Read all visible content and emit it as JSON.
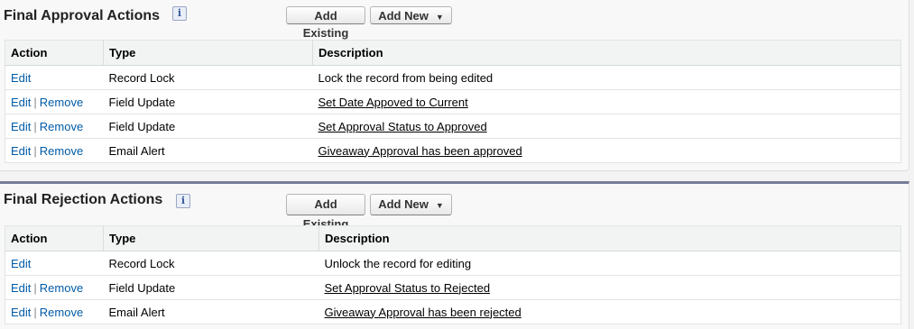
{
  "approval": {
    "title": "Final Approval Actions",
    "info_icon": "i",
    "add_existing": "Add Existing",
    "add_new": "Add New",
    "headers": {
      "action": "Action",
      "type": "Type",
      "description": "Description"
    },
    "rows": [
      {
        "edit": "Edit",
        "remove": "",
        "type": "Record Lock",
        "description": "Lock the record from being edited",
        "desc_is_link": false
      },
      {
        "edit": "Edit",
        "remove": "Remove",
        "type": "Field Update",
        "description": "Set Date Appoved to Current",
        "desc_is_link": true
      },
      {
        "edit": "Edit",
        "remove": "Remove",
        "type": "Field Update",
        "description": "Set Approval Status to Approved",
        "desc_is_link": true
      },
      {
        "edit": "Edit",
        "remove": "Remove",
        "type": "Email Alert",
        "description": "Giveaway Approval has been approved",
        "desc_is_link": true
      }
    ]
  },
  "rejection": {
    "title": "Final Rejection Actions",
    "info_icon": "i",
    "add_existing": "Add Existing",
    "add_new": "Add New",
    "headers": {
      "action": "Action",
      "type": "Type",
      "description": "Description"
    },
    "rows": [
      {
        "edit": "Edit",
        "remove": "",
        "type": "Record Lock",
        "description": "Unlock the record for editing",
        "desc_is_link": false
      },
      {
        "edit": "Edit",
        "remove": "Remove",
        "type": "Field Update",
        "description": "Set Approval Status to Rejected",
        "desc_is_link": true
      },
      {
        "edit": "Edit",
        "remove": "Remove",
        "type": "Email Alert",
        "description": "Giveaway Approval has been rejected",
        "desc_is_link": true
      }
    ]
  },
  "separator": "|",
  "colors": {
    "link": "#015ba7",
    "section_divider": "#747e96"
  }
}
